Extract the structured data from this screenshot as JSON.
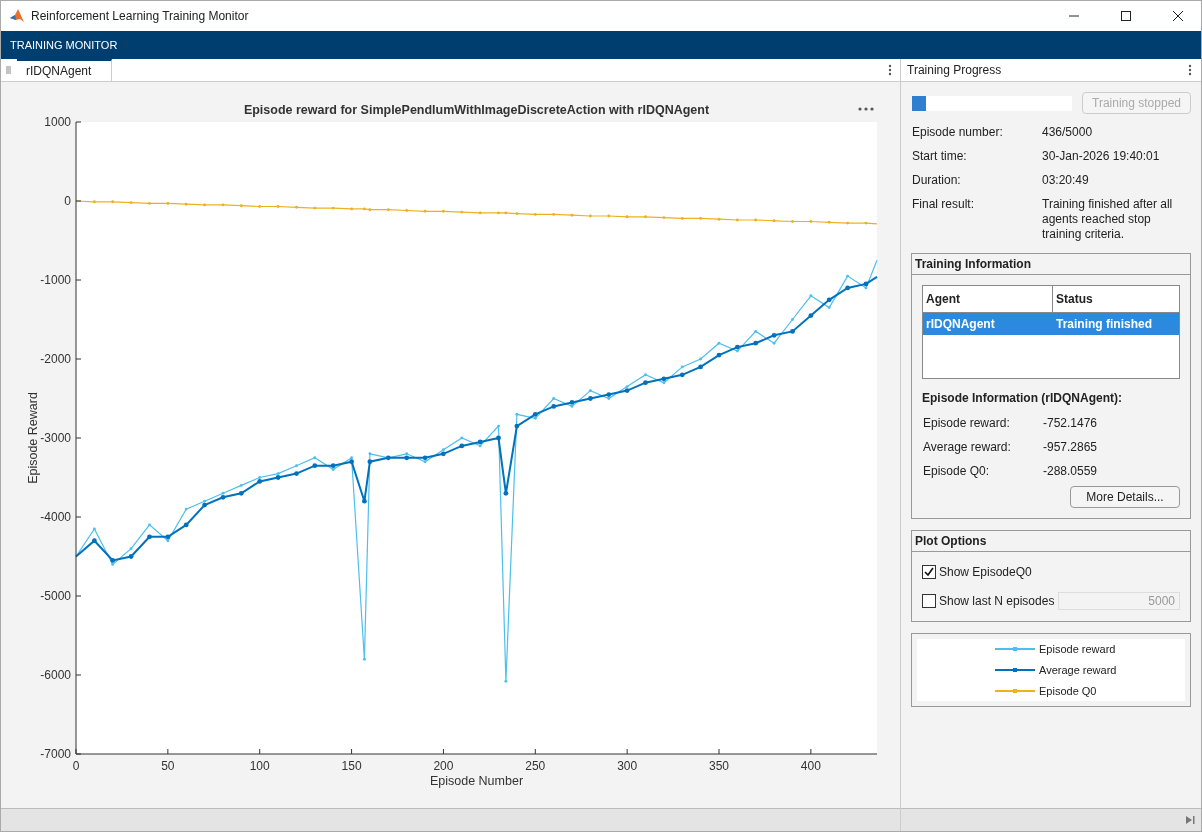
{
  "window": {
    "title": "Reinforcement Learning Training Monitor"
  },
  "app_bar": {
    "title": "TRAINING MONITOR"
  },
  "tabs": [
    {
      "label": "rIDQNAgent",
      "selected": true
    }
  ],
  "chart_data": {
    "type": "line",
    "title": "Episode reward for SimplePendlumWithImageDiscreteAction with rIDQNAgent",
    "xlabel": "Episode Number",
    "ylabel": "Episode Reward",
    "x": [
      0,
      10,
      20,
      30,
      40,
      50,
      60,
      70,
      80,
      90,
      100,
      110,
      120,
      130,
      140,
      150,
      157,
      160,
      170,
      180,
      190,
      200,
      210,
      220,
      230,
      234,
      240,
      250,
      260,
      270,
      280,
      290,
      300,
      310,
      320,
      330,
      340,
      350,
      360,
      370,
      380,
      390,
      400,
      410,
      420,
      430,
      436
    ],
    "series": [
      {
        "name": "Episode reward",
        "color": "#4dbeee",
        "values": [
          -4500,
          -4150,
          -4600,
          -4400,
          -4100,
          -4300,
          -3900,
          -3800,
          -3700,
          -3600,
          -3500,
          -3450,
          -3350,
          -3250,
          -3400,
          -3250,
          -5800,
          -3200,
          -3250,
          -3200,
          -3300,
          -3150,
          -3000,
          -3100,
          -2850,
          -6080,
          -2700,
          -2750,
          -2500,
          -2600,
          -2400,
          -2500,
          -2350,
          -2200,
          -2300,
          -2100,
          -2000,
          -1800,
          -1900,
          -1650,
          -1800,
          -1500,
          -1200,
          -1350,
          -950,
          -1100,
          -750
        ]
      },
      {
        "name": "Average reward",
        "color": "#0072bd",
        "values": [
          -4500,
          -4300,
          -4550,
          -4500,
          -4250,
          -4250,
          -4100,
          -3850,
          -3750,
          -3700,
          -3550,
          -3500,
          -3450,
          -3350,
          -3350,
          -3300,
          -3800,
          -3300,
          -3250,
          -3250,
          -3250,
          -3200,
          -3100,
          -3050,
          -3000,
          -3700,
          -2850,
          -2700,
          -2600,
          -2550,
          -2500,
          -2450,
          -2400,
          -2300,
          -2250,
          -2200,
          -2100,
          -1950,
          -1850,
          -1800,
          -1700,
          -1650,
          -1450,
          -1250,
          -1100,
          -1050,
          -960
        ]
      },
      {
        "name": "Episode Q0",
        "color": "#edb120",
        "values": [
          0,
          -10,
          -10,
          -20,
          -30,
          -30,
          -40,
          -50,
          -50,
          -60,
          -70,
          -70,
          -80,
          -90,
          -90,
          -100,
          -100,
          -110,
          -110,
          -120,
          -130,
          -130,
          -140,
          -150,
          -150,
          -150,
          -160,
          -170,
          -170,
          -180,
          -190,
          -190,
          -200,
          -200,
          -210,
          -220,
          -220,
          -230,
          -240,
          -240,
          -250,
          -260,
          -260,
          -270,
          -280,
          -280,
          -290
        ]
      }
    ],
    "xlim": [
      0,
      436
    ],
    "ylim": [
      -7000,
      1000
    ],
    "xticks": [
      0,
      50,
      100,
      150,
      200,
      250,
      300,
      350,
      400
    ],
    "yticks": [
      1000,
      0,
      -1000,
      -2000,
      -3000,
      -4000,
      -5000,
      -6000,
      -7000
    ]
  },
  "progress": {
    "title": "Training Progress",
    "level": 0.087,
    "button": {
      "label": "Training stopped",
      "disabled": true
    },
    "fields": [
      {
        "label": "Episode number:",
        "value": "436/5000"
      },
      {
        "label": "Start time:",
        "value": "30-Jan-2026 19:40:01"
      },
      {
        "label": "Duration:",
        "value": "03:20:49"
      },
      {
        "label": "Final result:",
        "value": "Training finished after all agents reached stop training criteria."
      }
    ]
  },
  "training_information": {
    "title": "Training Information",
    "columns": [
      "Agent",
      "Status"
    ],
    "rows": [
      {
        "agent": "rIDQNAgent",
        "status": "Training finished",
        "selected": true
      }
    ],
    "episode_title": "Episode Information (rIDQNAgent):",
    "fields": [
      {
        "label": "Episode reward:",
        "value": "-752.1476"
      },
      {
        "label": "Average reward:",
        "value": "-957.2865"
      },
      {
        "label": "Episode Q0:",
        "value": "-288.0559"
      }
    ],
    "button": "More Details..."
  },
  "plot_options": {
    "title": "Plot Options",
    "options": [
      {
        "kind": "checkbox",
        "label": "Show EpisodeQ0",
        "checked": true
      },
      {
        "kind": "checkbox",
        "label": "Show last N episodes",
        "checked": false,
        "input": {
          "value": "5000",
          "disabled": true
        }
      }
    ]
  }
}
